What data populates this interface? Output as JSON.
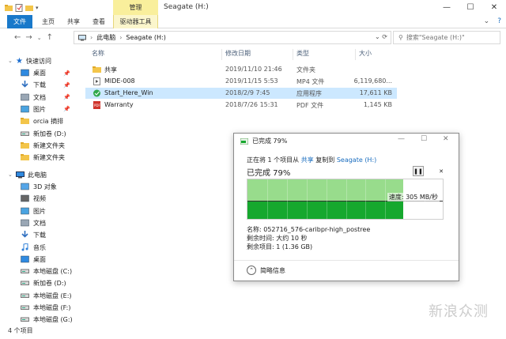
{
  "window": {
    "title": "Seagate (H:)",
    "context_tab": "管理",
    "controls": [
      "—",
      "☐",
      "✕"
    ]
  },
  "ribbon": {
    "tabs": [
      "文件",
      "主页",
      "共享",
      "查看",
      "驱动器工具"
    ]
  },
  "address": {
    "crumbs": [
      "此电脑",
      "Seagate (H:)"
    ],
    "search_placeholder": "搜索\"Seagate (H:)\""
  },
  "nav_pane": {
    "quick_access": "快速访问",
    "items": [
      {
        "label": "桌面",
        "icon": "desktop-icon",
        "pinned": true
      },
      {
        "label": "下载",
        "icon": "download-icon",
        "pinned": true
      },
      {
        "label": "文档",
        "icon": "documents-icon",
        "pinned": true
      },
      {
        "label": "图片",
        "icon": "pictures-icon",
        "pinned": true
      },
      {
        "label": "orcia 摘排",
        "icon": "folder-icon",
        "pinned": false
      },
      {
        "label": "新加卷 (D:)",
        "icon": "drive-icon",
        "pinned": false
      },
      {
        "label": "新建文件夹",
        "icon": "folder-icon",
        "pinned": false
      },
      {
        "label": "新建文件夹",
        "icon": "folder-icon",
        "pinned": false
      }
    ],
    "this_pc": "此电脑",
    "pc_items": [
      {
        "label": "3D 对象",
        "icon": "3d-objects-icon"
      },
      {
        "label": "视频",
        "icon": "videos-icon"
      },
      {
        "label": "图片",
        "icon": "pictures-icon"
      },
      {
        "label": "文档",
        "icon": "documents-icon"
      },
      {
        "label": "下载",
        "icon": "download-icon"
      },
      {
        "label": "音乐",
        "icon": "music-icon"
      },
      {
        "label": "桌面",
        "icon": "desktop-icon"
      },
      {
        "label": "本地磁盘 (C:)",
        "icon": "drive-icon"
      },
      {
        "label": "新加卷 (D:)",
        "icon": "drive-icon"
      },
      {
        "label": "本地磁盘 (E:)",
        "icon": "drive-icon"
      },
      {
        "label": "本地磁盘 (F:)",
        "icon": "drive-icon"
      },
      {
        "label": "本地磁盘 (G:)",
        "icon": "drive-icon"
      }
    ]
  },
  "file_list": {
    "headers": [
      "名称",
      "修改日期",
      "类型",
      "大小"
    ],
    "rows": [
      {
        "name": "共享",
        "date": "2019/11/10 21:46",
        "type": "文件夹",
        "size": "",
        "icon": "folder-icon",
        "selected": false
      },
      {
        "name": "MIDE-008",
        "date": "2019/11/15 5:53",
        "type": "MP4 文件",
        "size": "6,119,680...",
        "icon": "video-file-icon",
        "selected": false
      },
      {
        "name": "Start_Here_Win",
        "date": "2018/2/9 7:45",
        "type": "应用程序",
        "size": "17,611 KB",
        "icon": "app-icon",
        "selected": true
      },
      {
        "name": "Warranty",
        "date": "2018/7/26 15:31",
        "type": "PDF 文件",
        "size": "1,145 KB",
        "icon": "pdf-icon",
        "selected": false
      }
    ]
  },
  "status_bar": {
    "item_count": "4 个项目"
  },
  "watermark": "新浪众测",
  "copy_dialog": {
    "title": "已完成 79%",
    "controls": [
      "—",
      "☐",
      "✕"
    ],
    "line_prefix": "正在将 1 个项目从",
    "source": "共享",
    "line_mid": "复制到",
    "destination": "Seagate (H:)",
    "progress_text": "已完成 79%",
    "progress": 0.79,
    "speed": "速度: 305 MB/秒",
    "name_line": "名称: 052716_576-caribpr-high_postree",
    "time_line": "剩余时间: 大约 10 秒",
    "items_line": "剩余项目: 1 (1.36 GB)",
    "less_details": "简略信息",
    "pause": "❚❚",
    "cancel": "✕"
  }
}
